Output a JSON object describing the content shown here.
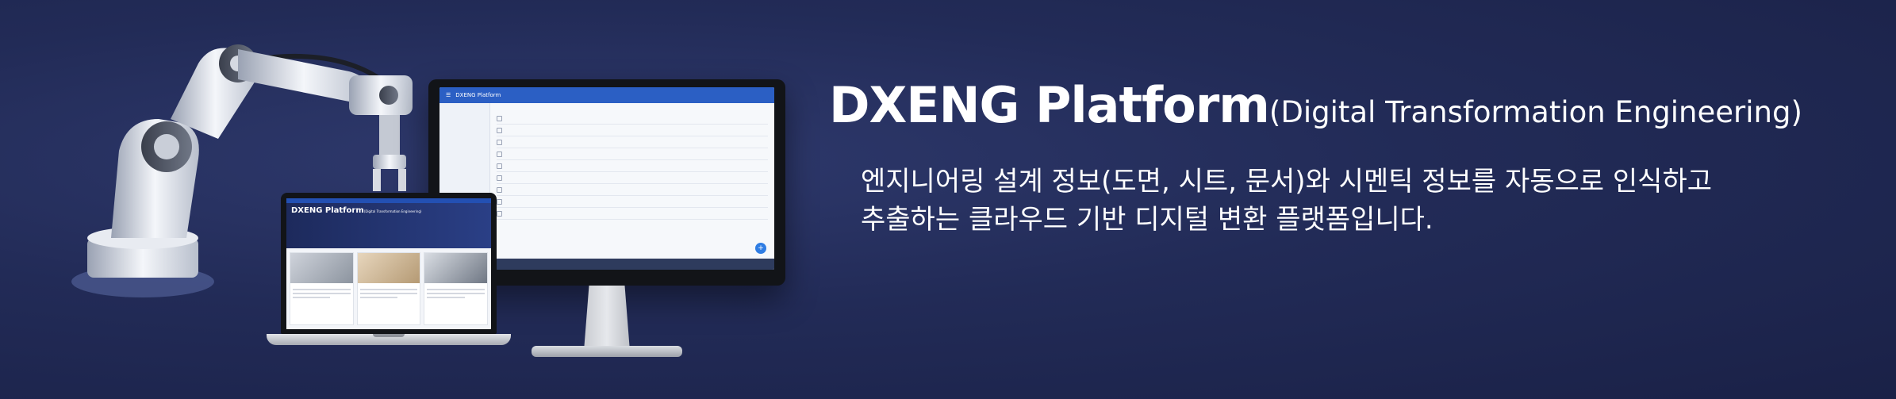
{
  "banner": {
    "brand_title": "DXENG Platform",
    "brand_subtitle": "(Digital Transformation Engineering)",
    "description_line1": "엔지니어링 설계 정보(도면, 시트, 문서)와 시멘틱 정보를 자동으로 인식하고",
    "description_line2": "추출하는 클라우드 기반 디지털 변환 플랫폼입니다."
  },
  "monitor_screen": {
    "app_title": "DXENG Platform",
    "add_icon": "+"
  },
  "laptop_screen": {
    "hero_title": "DXENG Platform",
    "hero_subtitle": "(Digital Transformation Engineering)"
  },
  "colors": {
    "background": "#222b57",
    "accent_blue": "#2b5fc4",
    "text": "#ffffff"
  },
  "icons": [
    "robot-arm-illustration",
    "desktop-monitor-mockup",
    "laptop-mockup",
    "add-fab-icon"
  ]
}
